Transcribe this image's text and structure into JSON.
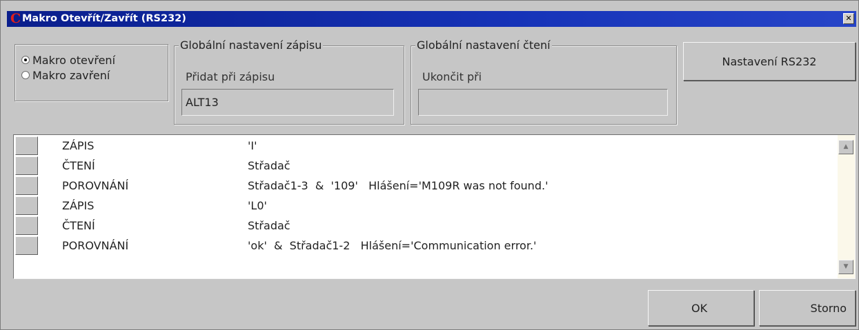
{
  "window": {
    "title": "Makro Otevřít/Zavřít (RS232)",
    "logo_glyph": "C",
    "close_glyph": "✕"
  },
  "mode": {
    "options": [
      {
        "label": "Makro otevření",
        "checked": true
      },
      {
        "label": "Makro zavření",
        "checked": false
      }
    ]
  },
  "write_settings": {
    "legend": "Globální nastavení zápisu",
    "label": "Přidat při zápisu",
    "value": "ALT13"
  },
  "read_settings": {
    "legend": "Globální nastavení čtení",
    "label": "Ukončit při",
    "value": ""
  },
  "buttons": {
    "rs232": "Nastavení RS232",
    "ok": "OK",
    "cancel": "Storno"
  },
  "steps": [
    {
      "type": "ZÁPIS",
      "param": "'I'"
    },
    {
      "type": "ČTENÍ",
      "param": "Střadač"
    },
    {
      "type": "POROVNÁNÍ",
      "param": "Střadač1-3  &  '109'   Hlášení='M109R was not found.'"
    },
    {
      "type": "ZÁPIS",
      "param": "'L0'"
    },
    {
      "type": "ČTENÍ",
      "param": "Střadač"
    },
    {
      "type": "POROVNÁNÍ",
      "param": "'ok'  &  Střadač1-2   Hlášení='Communication error.'"
    }
  ],
  "scrollbar": {
    "up_glyph": "▲",
    "down_glyph": "▼"
  },
  "colors": {
    "titlebar": "#1633b8",
    "logo": "#e0201a",
    "face": "#c6c6c6",
    "scroll_track": "#fbf8ea"
  }
}
